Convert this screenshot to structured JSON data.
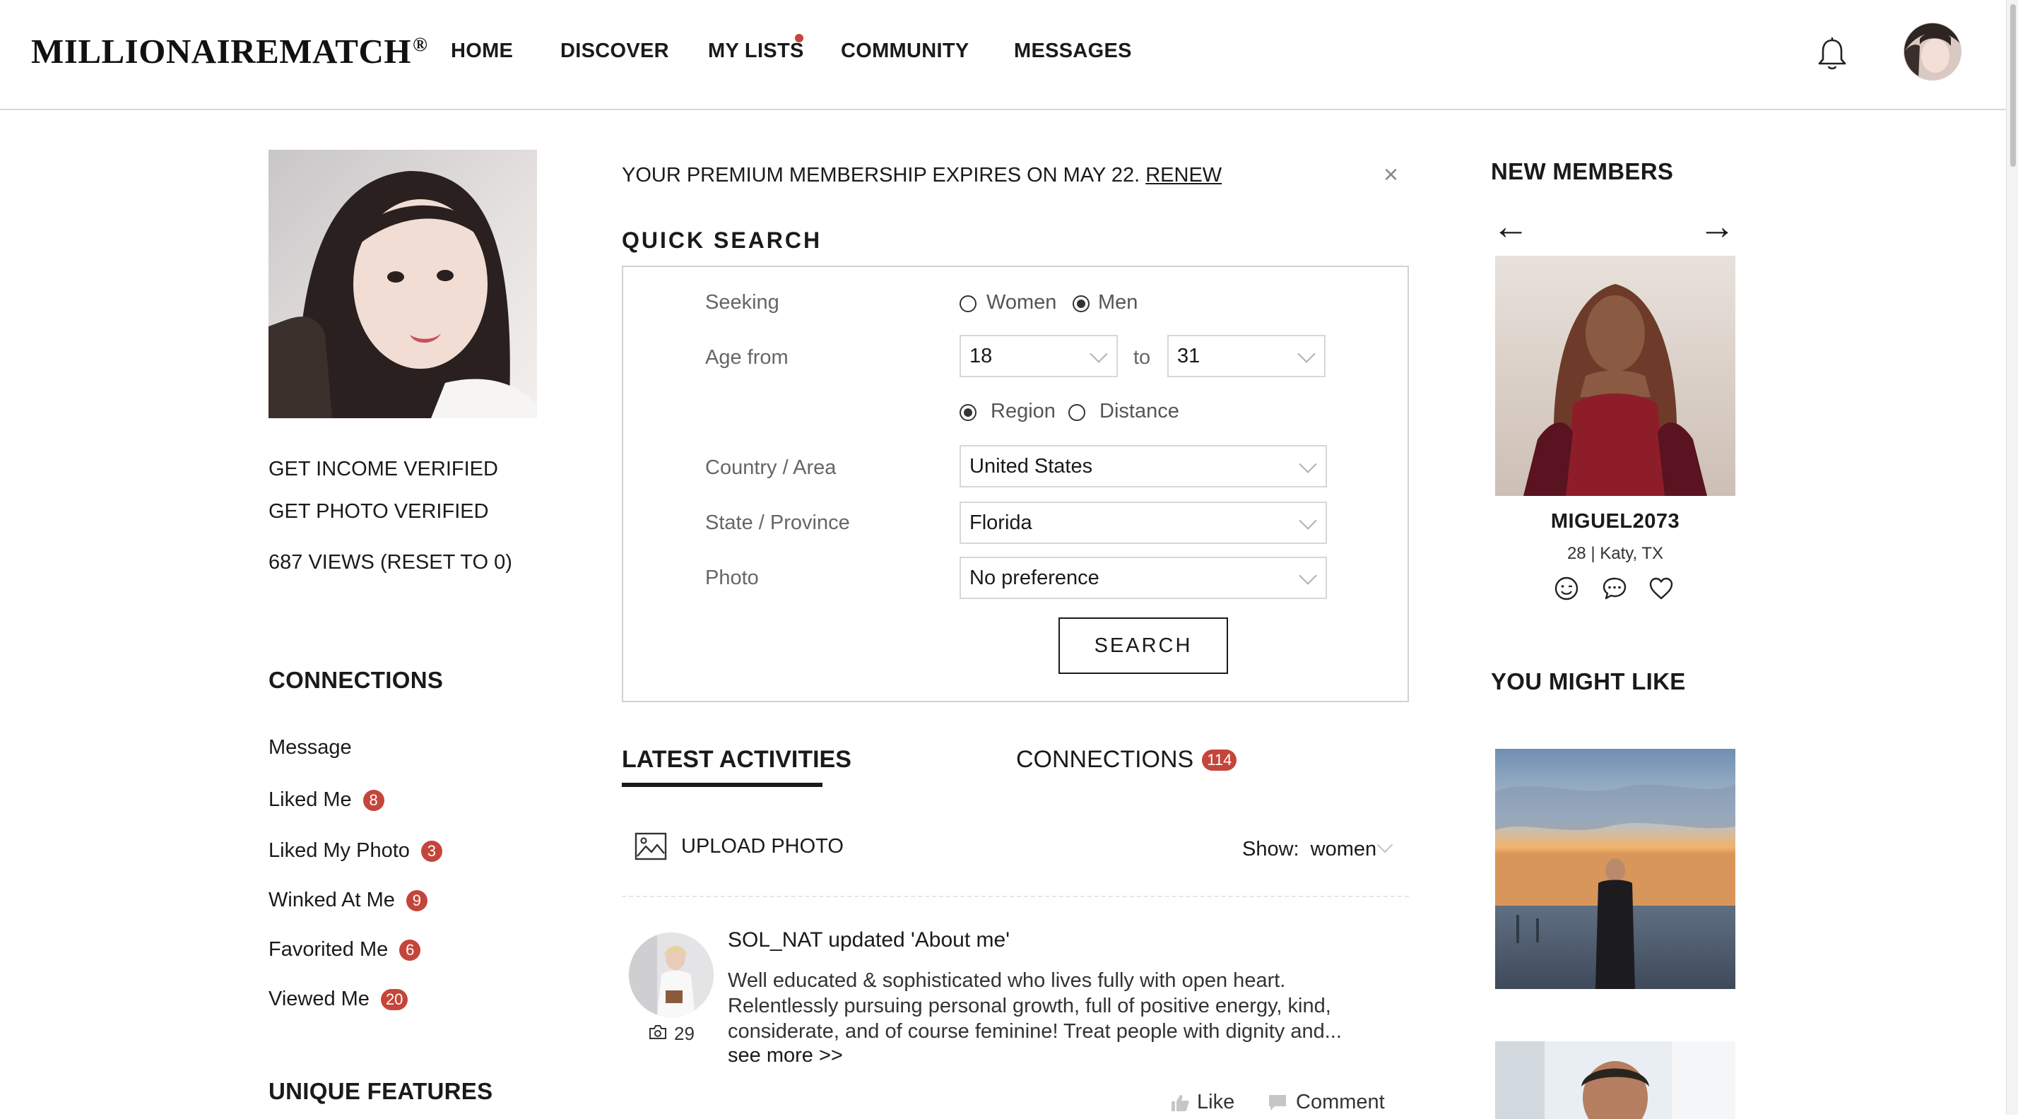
{
  "header": {
    "logo": "MILLIONAIREMATCH",
    "logo_mark": "®",
    "nav": [
      "HOME",
      "DISCOVER",
      "MY LISTS",
      "COMMUNITY",
      "MESSAGES"
    ],
    "notification_icon": "bell-icon",
    "colors": {
      "notification_dot": "#c4453a"
    }
  },
  "left": {
    "links": [
      "GET INCOME VERIFIED",
      "GET PHOTO VERIFIED",
      "687 VIEWS (RESET TO 0)"
    ],
    "connections_title": "CONNECTIONS",
    "connections": [
      {
        "label": "Message",
        "count": ""
      },
      {
        "label": "Liked Me",
        "count": "8"
      },
      {
        "label": "Liked My Photo",
        "count": "3"
      },
      {
        "label": "Winked At Me",
        "count": "9"
      },
      {
        "label": "Favorited Me",
        "count": "6"
      },
      {
        "label": "Viewed Me",
        "count": "20"
      }
    ],
    "unique_title": "UNIQUE FEATURES"
  },
  "center": {
    "premium_text": "YOUR PREMIUM MEMBERSHIP EXPIRES ON MAY 22.",
    "renew": "RENEW",
    "close": "×",
    "quick_search": {
      "title": "QUICK SEARCH",
      "seeking_label": "Seeking",
      "seeking_options": [
        "Women",
        "Men"
      ],
      "seeking_selected": "Men",
      "age_label": "Age from",
      "age_from": "18",
      "age_to_label": "to",
      "age_to": "31",
      "mode_options": [
        "Region",
        "Distance"
      ],
      "mode_selected": "Region",
      "country_label": "Country / Area",
      "country": "United States",
      "state_label": "State / Province",
      "state": "Florida",
      "photo_label": "Photo",
      "photo": "No preference",
      "search_button": "SEARCH"
    },
    "tabs": {
      "latest": "LATEST ACTIVITIES",
      "connections": "CONNECTIONS",
      "connections_count": "114"
    },
    "upload_label": "UPLOAD PHOTO",
    "show_label": "Show:",
    "show_value": "women",
    "activity": {
      "title": "SOL_NAT updated 'About me'",
      "body": "Well educated & sophisticated who lives fully with open heart. Relentlessly pursuing personal growth, full of positive energy, kind, considerate, and of course feminine! Treat people with dignity and...",
      "see_more": "see more >>",
      "photo_count": "29",
      "like": "Like",
      "comment": "Comment"
    }
  },
  "right": {
    "new_members_title": "NEW MEMBERS",
    "prev_arrow": "←",
    "next_arrow": "→",
    "member": {
      "name": "MIGUEL2073",
      "meta": "28 | Katy, TX"
    },
    "you_might_like_title": "YOU MIGHT LIKE"
  }
}
